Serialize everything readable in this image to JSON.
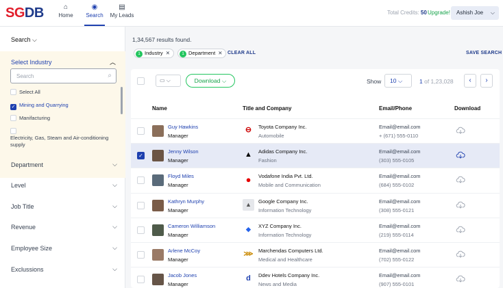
{
  "brand": {
    "logo_a": "SG",
    "logo_b": "DB"
  },
  "nav": [
    {
      "label": "Home",
      "icon": "home-icon",
      "glyph": "⌂"
    },
    {
      "label": "Search",
      "icon": "search-icon",
      "glyph": "◉"
    },
    {
      "label": "My Leads",
      "icon": "leads-icon",
      "glyph": "▤"
    }
  ],
  "header": {
    "credits_label": "Total Credits:",
    "credits_value": "50",
    "upgrade": "Upgrade!",
    "user": "Ashish Joe"
  },
  "sidebar": {
    "search_title": "Search",
    "industry": {
      "title": "Select Industry",
      "search_placeholder": "Search",
      "options": [
        {
          "label": "Select All",
          "checked": false
        },
        {
          "label": "Mining and Quarrying",
          "checked": true
        },
        {
          "label": "Manifacturing",
          "checked": false
        },
        {
          "label": "Electricity, Gas, Steam and Air-conditioning supply",
          "checked": false
        }
      ]
    },
    "filters": [
      "Department",
      "Level",
      "Job Title",
      "Revenue",
      "Employee Size",
      "Exclussions"
    ]
  },
  "main": {
    "results": "1,34,567 results found.",
    "chips": [
      {
        "count": "1",
        "label": "Industry"
      },
      {
        "count": "1",
        "label": "Department"
      }
    ],
    "clear_all": "CLEAR ALL",
    "save_search": "SAVE SEARCH",
    "toolbar": {
      "download": "Download",
      "show_label": "Show",
      "show_value": "10",
      "page_current": "1",
      "page_total": "of 1,23,028"
    },
    "columns": [
      "Name",
      "Title and Company",
      "Email/Phone",
      "Download"
    ],
    "rows": [
      {
        "name": "Guy Hawkins",
        "title": "Manager",
        "company": "Toyota Company Inc.",
        "industry": "Automobile",
        "email": "Email@email.com",
        "phone": "+ (671) 555-0110",
        "selected": false,
        "logo": "toyota"
      },
      {
        "name": "Jenny Wilson",
        "title": "Manager",
        "company": "Adidas Company Inc.",
        "industry": "Fashion",
        "email": "Email@email.com",
        "phone": "(303) 555-0105",
        "selected": true,
        "logo": "adidas"
      },
      {
        "name": "Floyd Miles",
        "title": "Manager",
        "company": "Vodafone India Pvt. Ltd.",
        "industry": "Mobile and Communication",
        "email": "Email@email.com",
        "phone": "(684) 555-0102",
        "selected": false,
        "logo": "vodafone"
      },
      {
        "name": "Kathryn Murphy",
        "title": "Manager",
        "company": "Google Company Inc.",
        "industry": "Information Technology",
        "email": "Email@email.com",
        "phone": "(308) 555-0121",
        "selected": false,
        "logo": "google"
      },
      {
        "name": "Cameron Williamson",
        "title": "Manager",
        "company": "XYZ Company Inc.",
        "industry": "Information Technology",
        "email": "Email@email.com",
        "phone": "(219) 555-0114",
        "selected": false,
        "logo": "xyz"
      },
      {
        "name": "Arlene McCoy",
        "title": "Manager",
        "company": "Marchendas Computers Ltd.",
        "industry": "Medical and Healthcare",
        "email": "Email@email.com",
        "phone": "(702) 555-0122",
        "selected": false,
        "logo": "marchendas"
      },
      {
        "name": "Jacob Jones",
        "title": "Manager",
        "company": "Ddev Hotels Company Inc.",
        "industry": "News and Media",
        "email": "Email@email.com",
        "phone": "(907) 555-0101",
        "selected": false,
        "logo": "ddev"
      }
    ]
  },
  "colors": {
    "accent": "#1e40af",
    "brand_red": "#e11d2a",
    "success": "#22c55e",
    "selected_row": "#e6eaf6",
    "filter_panel": "#fdf8ea"
  }
}
